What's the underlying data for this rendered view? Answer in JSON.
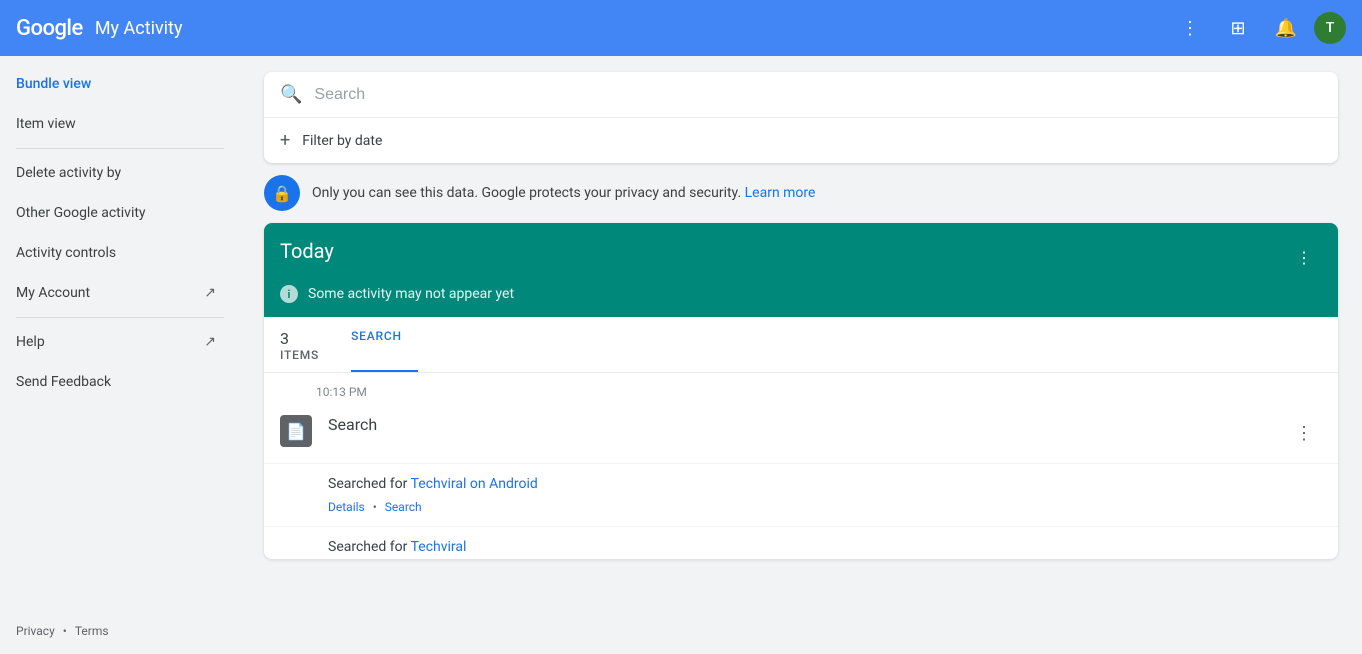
{
  "header": {
    "google_text": "Google",
    "title": "My Activity",
    "avatar_letter": "T"
  },
  "sidebar": {
    "items": [
      {
        "id": "bundle-view",
        "label": "Bundle view",
        "active": true,
        "external": false
      },
      {
        "id": "item-view",
        "label": "Item view",
        "active": false,
        "external": false
      }
    ],
    "secondary_items": [
      {
        "id": "delete-activity",
        "label": "Delete activity by",
        "active": false,
        "external": false
      },
      {
        "id": "other-google",
        "label": "Other Google activity",
        "active": false,
        "external": false
      },
      {
        "id": "activity-controls",
        "label": "Activity controls",
        "active": false,
        "external": false
      },
      {
        "id": "my-account",
        "label": "My Account",
        "active": false,
        "external": true
      },
      {
        "id": "help",
        "label": "Help",
        "active": false,
        "external": true
      },
      {
        "id": "send-feedback",
        "label": "Send Feedback",
        "active": false,
        "external": false
      }
    ],
    "footer": {
      "privacy": "Privacy",
      "terms": "Terms",
      "dot": "•"
    }
  },
  "search": {
    "placeholder": "Search",
    "filter_label": "Filter by date"
  },
  "privacy_notice": {
    "text": "Only you can see this data. Google protects your privacy and security.",
    "link_text": "Learn more"
  },
  "today_section": {
    "title": "Today",
    "notice": "Some activity may not appear yet",
    "tabs": [
      {
        "id": "items",
        "label": "ITEMS",
        "count": "3",
        "active": false
      },
      {
        "id": "search",
        "label": "SEARCH",
        "count": "",
        "active": true
      }
    ]
  },
  "activity": {
    "time": "10:13 PM",
    "title": "Search",
    "items": [
      {
        "prefix": "Searched for",
        "query": "Techviral on Android",
        "link": true,
        "links": [
          "Details",
          "Search"
        ]
      },
      {
        "prefix": "Searched for",
        "query": "Techviral",
        "link": true,
        "links": []
      }
    ]
  },
  "icons": {
    "search": "🔍",
    "plus": "+",
    "lock": "🔒",
    "document": "📄",
    "info": "i",
    "three_dots": "⋮",
    "external": "↗"
  }
}
